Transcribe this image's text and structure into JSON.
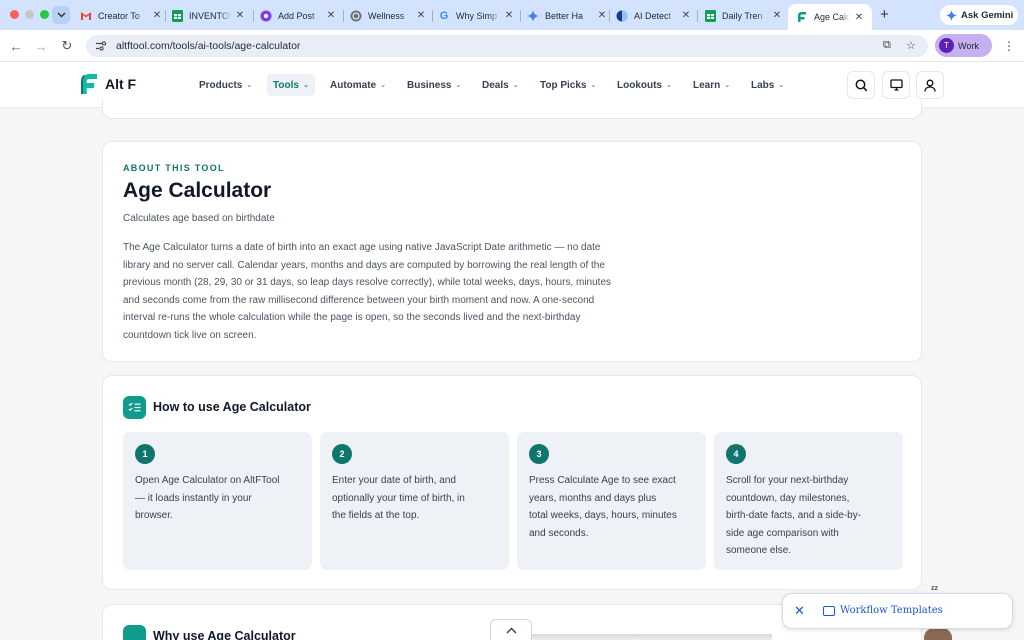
{
  "browser": {
    "tabs": [
      {
        "title": "Creator To",
        "icon": "gmail-icon"
      },
      {
        "title": "INVENTOR",
        "icon": "sheets-icon"
      },
      {
        "title": "Add Post",
        "icon": "purple-app-icon"
      },
      {
        "title": "Wellness",
        "icon": "wellness-icon"
      },
      {
        "title": "Why Simp",
        "icon": "google-icon"
      },
      {
        "title": "Better Ha",
        "icon": "gemini-icon"
      },
      {
        "title": "AI Detect",
        "icon": "ai-detector-icon"
      },
      {
        "title": "Daily Tren",
        "icon": "sheets-icon"
      },
      {
        "title": "Age Calcu",
        "icon": "altf-icon",
        "active": true
      }
    ],
    "ask_gemini": "Ask Gemini",
    "url": "altftool.com/tools/ai-tools/age-calculator",
    "profile_initial": "T",
    "profile_name": "Work"
  },
  "site": {
    "logo_text": "Alt F",
    "nav": [
      {
        "label": "Products"
      },
      {
        "label": "Tools",
        "active": true
      },
      {
        "label": "Automate"
      },
      {
        "label": "Business"
      },
      {
        "label": "Deals"
      },
      {
        "label": "Top Picks"
      },
      {
        "label": "Lookouts"
      },
      {
        "label": "Learn"
      },
      {
        "label": "Labs"
      }
    ]
  },
  "about": {
    "eyebrow": "ABOUT THIS TOOL",
    "title": "Age Calculator",
    "subtitle": "Calculates age based on birthdate",
    "lines": [
      "The Age Calculator turns a date of birth into an exact age using native JavaScript Date arithmetic — no date",
      "library and no server call. Calendar years, months and days are computed by borrowing the real length of the",
      "previous month (28, 29, 30 or 31 days, so leap days resolve correctly), while total weeks, days, hours, minutes",
      "and seconds come from the raw millisecond difference between your birth moment and now. A one-second",
      "interval re-runs the whole calculation while the page is open, so the seconds lived and the next-birthday",
      "countdown tick live on screen."
    ]
  },
  "howto": {
    "title": "How to use Age Calculator",
    "steps": [
      {
        "num": "1",
        "lines": [
          "Open Age Calculator on AltFTool",
          "— it loads instantly in your",
          "browser."
        ]
      },
      {
        "num": "2",
        "lines": [
          "Enter your date of birth, and",
          "optionally your time of birth, in",
          "the fields at the top."
        ]
      },
      {
        "num": "3",
        "lines": [
          "Press Calculate Age to see exact",
          "years, months and days plus",
          "total weeks, days, hours, minutes",
          "and seconds."
        ]
      },
      {
        "num": "4",
        "lines": [
          "Scroll for your next-birthday",
          "countdown, day milestones,",
          "birth-date facts, and a side-by-",
          "side age comparison with",
          "someone else."
        ]
      }
    ]
  },
  "why": {
    "title": "Why use Age Calculator"
  },
  "widget": {
    "workflow_label": "Workflow Templates",
    "zz": "zz"
  },
  "colors": {
    "accent": "#0f766e",
    "icon_bg": "#0f9c8c",
    "tabstrip": "#d3e3fd",
    "link_blue": "#1a56db"
  }
}
